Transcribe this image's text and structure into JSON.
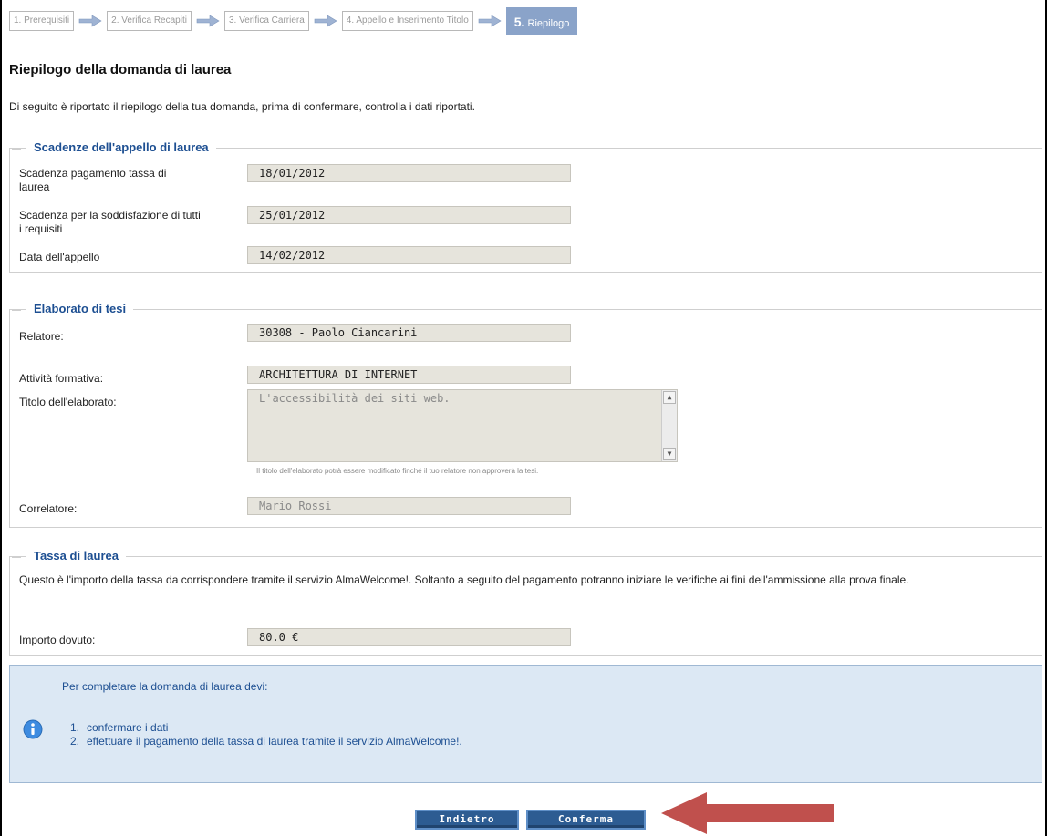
{
  "wizard": {
    "steps": [
      {
        "label": "1. Prerequisiti"
      },
      {
        "label": "2. Verifica Recapiti"
      },
      {
        "label": "3. Verifica Carriera"
      },
      {
        "label": "4. Appello e Inserimento Titolo"
      }
    ],
    "active_num": "5.",
    "active_label": "Riepilogo"
  },
  "page": {
    "title": "Riepilogo della domanda di laurea",
    "intro": "Di seguito è riportato il riepilogo della tua domanda, prima di confermare, controlla i dati riportati."
  },
  "scadenze": {
    "legend": "Scadenze dell'appello di laurea",
    "fields": [
      {
        "label": "Scadenza pagamento tassa di laurea",
        "value": "18/01/2012"
      },
      {
        "label": "Scadenza per la soddisfazione di tutti i requisiti",
        "value": "25/01/2012"
      },
      {
        "label": "Data dell'appello",
        "value": "14/02/2012"
      }
    ]
  },
  "tesi": {
    "legend": "Elaborato di tesi",
    "relatore_label": "Relatore:",
    "relatore_value": "30308 - Paolo Ciancarini",
    "attivita_label": "Attività formativa:",
    "attivita_value": "ARCHITETTURA DI INTERNET",
    "titolo_label": "Titolo dell'elaborato:",
    "titolo_value": "L'accessibilità dei siti web.",
    "titolo_hint": "Il titolo dell'elaborato potrà essere modificato finché il tuo relatore non approverà la tesi.",
    "correlatore_label": "Correlatore:",
    "correlatore_value": "Mario Rossi"
  },
  "tassa": {
    "legend": "Tassa di laurea",
    "description": "Questo è l'importo della tassa da corrispondere tramite il servizio AlmaWelcome!. Soltanto a seguito del pagamento potranno iniziare le verifiche ai fini dell'ammissione alla prova finale.",
    "importo_label": "Importo dovuto:",
    "importo_value": "80.0 €"
  },
  "info": {
    "title": "Per completare la domanda di laurea devi:",
    "items": [
      {
        "num": "1.",
        "text": "confermare i dati"
      },
      {
        "num": "2.",
        "text": "effettuare il pagamento della tassa di laurea tramite il servizio AlmaWelcome!."
      }
    ]
  },
  "buttons": {
    "back": "Indietro",
    "confirm": "Conferma"
  },
  "colors": {
    "accent": "#1d4f92",
    "active_step": "#8aa3c9",
    "button": "#2d5c92",
    "annotation_arrow": "#c0504d"
  }
}
